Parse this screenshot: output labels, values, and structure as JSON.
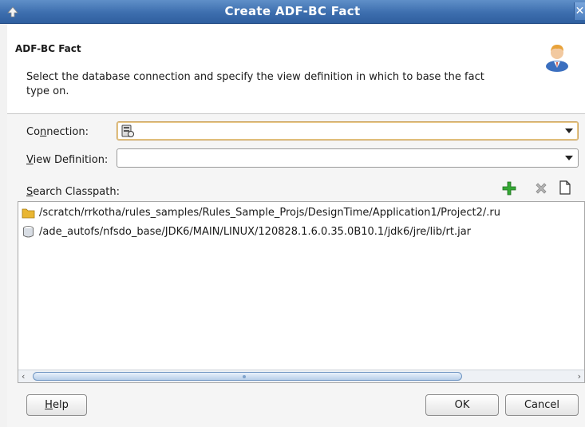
{
  "window": {
    "title": "Create ADF-BC Fact",
    "close_glyph": "✕"
  },
  "header": {
    "heading": "ADF-BC Fact",
    "description": "Select the database connection and specify the view definition in which to base the fact type on.",
    "icon": "user-icon"
  },
  "form": {
    "connection_label_pre": "Co",
    "connection_label_mn": "n",
    "connection_label_post": "nection:",
    "connection_value": "",
    "view_def_label_mn": "V",
    "view_def_label_post": "iew Definition:",
    "view_def_value": "",
    "classpath_label_mn": "S",
    "classpath_label_post": "earch Classpath:"
  },
  "toolbar": {
    "add": "add-icon",
    "remove": "delete-icon",
    "new": "new-file-icon"
  },
  "classpath": {
    "items": [
      {
        "icon": "folder-icon",
        "path": "/scratch/rrkotha/rules_samples/Rules_Sample_Projs/DesignTime/Application1/Project2/.ru"
      },
      {
        "icon": "jar-icon",
        "path": "/ade_autofs/nfsdo_base/JDK6/MAIN/LINUX/120828.1.6.0.35.0B10.1/jdk6/jre/lib/rt.jar"
      }
    ]
  },
  "buttons": {
    "help_mn": "H",
    "help_rest": "elp",
    "ok": "OK",
    "cancel": "Cancel"
  },
  "colors": {
    "titlebar": "#3d6eae",
    "connection_focus": "#c9a15b",
    "add_icon": "#2ea12e"
  }
}
